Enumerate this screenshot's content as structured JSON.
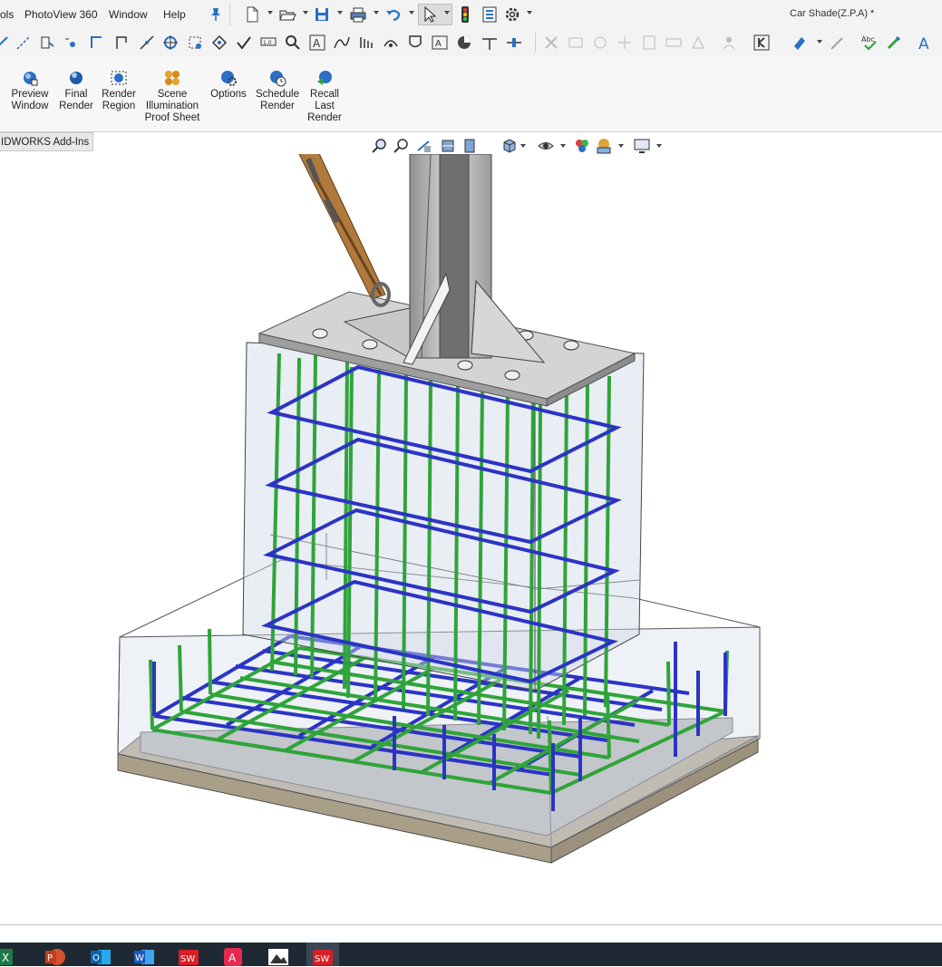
{
  "menu": {
    "items": [
      "ols",
      "PhotoView 360",
      "Window",
      "Help"
    ],
    "document_title": "Car Shade(Z.P.A) *"
  },
  "ribbon": {
    "buttons": [
      {
        "label": "Preview\nWindow",
        "icon": "preview-window-icon"
      },
      {
        "label": "Final\nRender",
        "icon": "final-render-icon"
      },
      {
        "label": "Render\nRegion",
        "icon": "render-region-icon"
      },
      {
        "label": "Scene\nIllumination\nProof Sheet",
        "icon": "scene-illumination-icon"
      },
      {
        "label": "Options",
        "icon": "options-icon"
      },
      {
        "label": "Schedule\nRender",
        "icon": "schedule-render-icon"
      },
      {
        "label": "Recall\nLast\nRender",
        "icon": "recall-last-render-icon"
      }
    ],
    "active_tab": "IDWORKS Add-Ins"
  },
  "colors": {
    "rebar_vertical": "#2fa43a",
    "rebar_stirrup": "#2b34c4",
    "concrete_glass": "#c9d3e2",
    "lean_concrete": "#b7ab95",
    "steel": "#b9b9b9",
    "taskbar": "#1f2933"
  },
  "taskbar": {
    "apps": [
      "excel-icon",
      "powerpoint-icon",
      "outlook-icon",
      "word-icon",
      "solidworks-icon",
      "acrobat-icon",
      "photos-icon",
      "solidworks-active-icon"
    ]
  }
}
